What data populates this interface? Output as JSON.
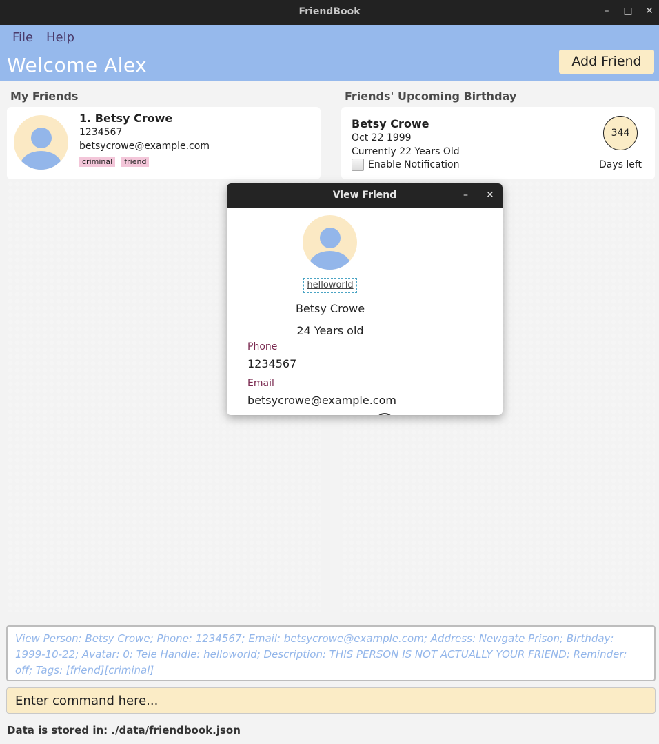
{
  "window": {
    "title": "FriendBook",
    "minimize_glyph": "–",
    "maximize_glyph": "□",
    "close_glyph": "✕"
  },
  "menu": {
    "file": "File",
    "help": "Help"
  },
  "header": {
    "welcome": "Welcome Alex",
    "add_friend": "Add Friend"
  },
  "friends": {
    "title": "My Friends",
    "items": [
      {
        "name": "1. Betsy Crowe",
        "phone": "1234567",
        "email": "betsycrowe@example.com",
        "tags": [
          "criminal",
          "friend"
        ]
      }
    ]
  },
  "birthdays": {
    "title": "Friends' Upcoming Birthday",
    "items": [
      {
        "name": "Betsy Crowe",
        "date": "Oct 22 1999",
        "age": "Currently 22 Years Old",
        "notification": "Enable Notification",
        "days": "344",
        "days_label": "Days left"
      }
    ]
  },
  "dialog": {
    "title": "View Friend",
    "minimize_glyph": "–",
    "close_glyph": "✕",
    "handle": "helloworld",
    "name": "Betsy Crowe",
    "age": "24 Years old",
    "phone_label": "Phone",
    "phone": "1234567",
    "email_label": "Email",
    "email": "betsycrowe@example.com"
  },
  "result": "View Person: Betsy Crowe; Phone: 1234567; Email: betsycrowe@example.com; Address: Newgate Prison; Birthday: 1999-10-22; Avatar: 0; Tele Handle: helloworld; Description: THIS PERSON IS NOT ACTUALLY YOUR FRIEND; Reminder: off; Tags: [friend][criminal]",
  "command": {
    "placeholder": "Enter command here..."
  },
  "status": "Data is stored in: ./data/friendbook.json",
  "colors": {
    "header": "#96b9ec",
    "accent_cream": "#fbecc6",
    "tag_pink": "#f3c6d9",
    "label_maroon": "#7a2a50"
  }
}
